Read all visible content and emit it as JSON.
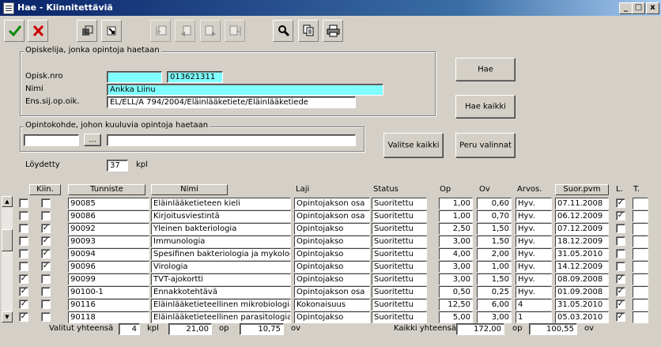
{
  "window": {
    "title": "Hae - Kiinnitettäviä",
    "min": "_",
    "max": "□",
    "close": "x"
  },
  "toolbar": {
    "icons": [
      "check-icon",
      "cross-icon",
      "restore-icon",
      "goto-icon",
      "first-icon",
      "prev-icon",
      "next-icon",
      "last-icon",
      "search-icon",
      "copy-icon",
      "print-icon"
    ]
  },
  "student": {
    "legend": "Opiskelija, jonka opintoja haetaan",
    "nro_label": "Opisk.nro",
    "nro_value": "013621311",
    "name_label": "Nimi",
    "name_value": "Ankka Liinu",
    "ens_label": "Ens.sij.op.oik.",
    "ens_value": "EL/ELL/A 794/2004/Eläinlääketiete/Eläinlääketiede"
  },
  "target": {
    "legend": "Opintokohde, johon kuuluvia opintoja haetaan",
    "browse": "..."
  },
  "buttons": {
    "hae": "Hae",
    "hae_kaikki": "Hae kaikki",
    "valitse_kaikki": "Valitse kaikki",
    "peru_valinnat": "Peru valinnat"
  },
  "found": {
    "label": "Löydetty",
    "value": "37",
    "unit": "kpl"
  },
  "columns": {
    "kiin": "Kiin.",
    "tunniste": "Tunniste",
    "nimi": "Nimi",
    "laji": "Laji",
    "status": "Status",
    "op": "Op",
    "ov": "Ov",
    "arvos": "Arvos.",
    "suor_pvm": "Suor.pvm",
    "l": "L.",
    "t": "T."
  },
  "rows": [
    {
      "sel": false,
      "kiin": false,
      "id": "90085",
      "name": "Eläinlääketieteen kieli",
      "laji": "Opintojakson osa",
      "status": "Suoritettu",
      "op": "1,00",
      "ov": "0,60",
      "arvos": "Hyv.",
      "date": "07.11.2008",
      "l": true
    },
    {
      "sel": false,
      "kiin": false,
      "id": "90086",
      "name": "Kirjoitusviestintä",
      "laji": "Opintojakson osa",
      "status": "Suoritettu",
      "op": "1,00",
      "ov": "0,70",
      "arvos": "Hyv.",
      "date": "06.12.2009",
      "l": true
    },
    {
      "sel": false,
      "kiin": true,
      "id": "90092",
      "name": "Yleinen bakteriologia",
      "laji": "Opintojakso",
      "status": "Suoritettu",
      "op": "2,50",
      "ov": "1,50",
      "arvos": "Hyv.",
      "date": "07.12.2009",
      "l": false
    },
    {
      "sel": false,
      "kiin": true,
      "id": "90093",
      "name": "Immunologia",
      "laji": "Opintojakso",
      "status": "Suoritettu",
      "op": "3,00",
      "ov": "1,50",
      "arvos": "Hyv.",
      "date": "18.12.2009",
      "l": false
    },
    {
      "sel": false,
      "kiin": true,
      "id": "90094",
      "name": "Spesifinen bakteriologia ja mykologia",
      "laji": "Opintojakso",
      "status": "Suoritettu",
      "op": "4,00",
      "ov": "2,00",
      "arvos": "Hyv.",
      "date": "31.05.2010",
      "l": false
    },
    {
      "sel": false,
      "kiin": true,
      "id": "90096",
      "name": "Virologia",
      "laji": "Opintojakso",
      "status": "Suoritettu",
      "op": "3,00",
      "ov": "1,00",
      "arvos": "Hyv.",
      "date": "14.12.2009",
      "l": false
    },
    {
      "sel": true,
      "kiin": false,
      "id": "90099",
      "name": "TVT-ajokortti",
      "laji": "Opintojakso",
      "status": "Suoritettu",
      "op": "3,00",
      "ov": "1,50",
      "arvos": "Hyv.",
      "date": "08.09.2008",
      "l": true
    },
    {
      "sel": true,
      "kiin": false,
      "id": "90100-1",
      "name": "Ennakkotehtävä",
      "laji": "Opintojakson osa",
      "status": "Suoritettu",
      "op": "0,50",
      "ov": "0,25",
      "arvos": "Hyv.",
      "date": "01.09.2008",
      "l": true
    },
    {
      "sel": true,
      "kiin": false,
      "id": "90116",
      "name": "Eläinlääketieteellinen mikrobiologia ja",
      "laji": "Kokonaisuus",
      "status": "Suoritettu",
      "op": "12,50",
      "ov": "6,00",
      "arvos": "4",
      "date": "31.05.2010",
      "l": true
    },
    {
      "sel": true,
      "kiin": false,
      "id": "90118",
      "name": "Eläinlääketieteellinen parasitologia",
      "laji": "Opintojakso",
      "status": "Suoritettu",
      "op": "5,00",
      "ov": "3,00",
      "arvos": "1",
      "date": "05.03.2010",
      "l": true
    }
  ],
  "totals": {
    "selected_label": "Valitut yhteensä",
    "selected_count": "4",
    "kpl": "kpl",
    "selected_op": "21,00",
    "op": "op",
    "selected_ov": "10,75",
    "ov": "ov",
    "all_label": "Kaikki yhteensä",
    "all_op": "172,00",
    "all_ov": "100,55"
  }
}
